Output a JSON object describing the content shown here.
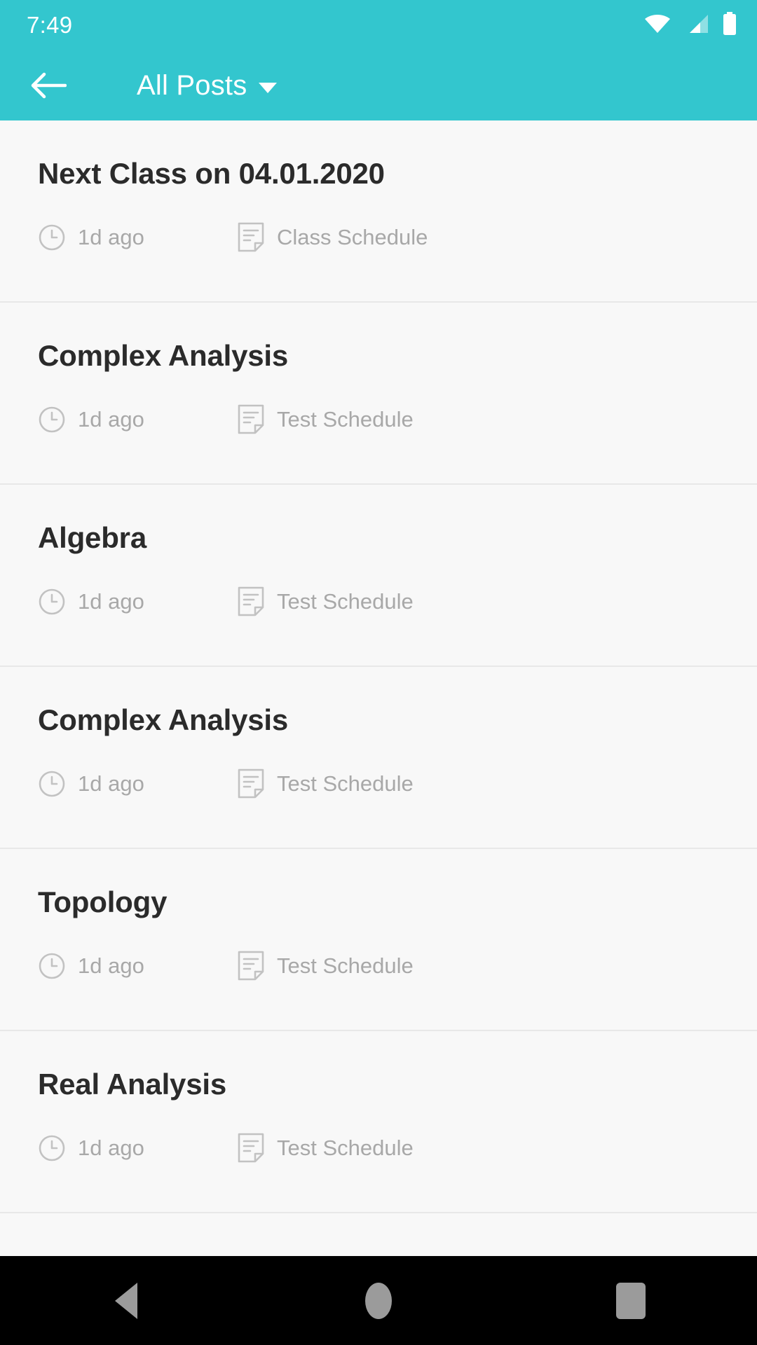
{
  "status_bar": {
    "time": "7:49",
    "icons": [
      {
        "name": "wifi-icon",
        "label": "wifi"
      },
      {
        "name": "cellular-signal-icon",
        "label": "cellular"
      },
      {
        "name": "battery-icon",
        "label": "battery"
      }
    ]
  },
  "app_bar": {
    "back_label": "Back",
    "title": "All Posts",
    "dropdown_indicator": "caret-down"
  },
  "colors": {
    "accent": "#33C6CE",
    "background": "#F8F8F8",
    "title_text": "#2B2B2B",
    "meta_text": "#A8A8A8",
    "divider": "#E8E8E8",
    "nav_bar": "#000000",
    "nav_icon": "#9B9B9B"
  },
  "list": {
    "items": [
      {
        "title": "Next Class on 04.01.2020",
        "time": "1d ago",
        "category": "Class Schedule"
      },
      {
        "title": "Complex Analysis",
        "time": "1d ago",
        "category": "Test Schedule"
      },
      {
        "title": "Algebra",
        "time": "1d ago",
        "category": "Test Schedule"
      },
      {
        "title": "Complex Analysis",
        "time": "1d ago",
        "category": "Test Schedule"
      },
      {
        "title": "Topology",
        "time": "1d ago",
        "category": "Test Schedule"
      },
      {
        "title": "Real Analysis",
        "time": "1d ago",
        "category": "Test Schedule"
      }
    ]
  },
  "nav_bar": {
    "back_label": "Back",
    "home_label": "Home",
    "recents_label": "Recents"
  }
}
